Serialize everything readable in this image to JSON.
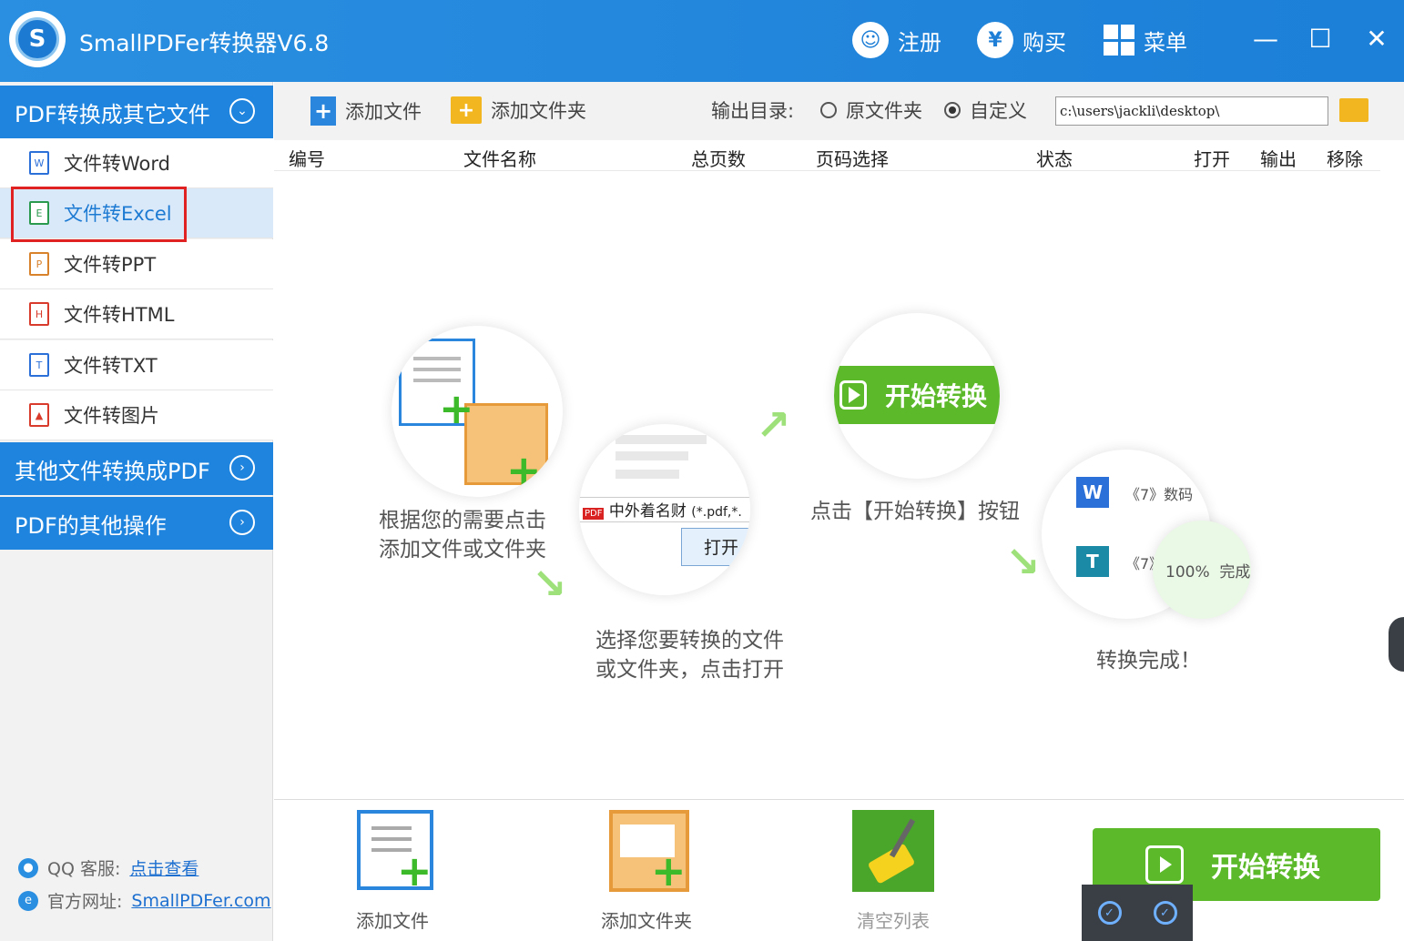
{
  "app": {
    "title": "SmallPDFer转换器V6.8",
    "logo_letter": "S"
  },
  "titlebar": {
    "register": "注册",
    "buy": "购买",
    "menu": "菜单",
    "yen": "¥"
  },
  "sidebar": {
    "sections": [
      "PDF转换成其它文件",
      "其他文件转换成PDF",
      "PDF的其他操作"
    ],
    "items": [
      {
        "label": "文件转Word",
        "icon": "W"
      },
      {
        "label": "文件转Excel",
        "icon": "E"
      },
      {
        "label": "文件转PPT",
        "icon": "P"
      },
      {
        "label": "文件转HTML",
        "icon": "H"
      },
      {
        "label": "文件转TXT",
        "icon": "T"
      },
      {
        "label": "文件转图片",
        "icon": "▲"
      }
    ],
    "qq_label": "QQ 客服:",
    "qq_link": "点击查看",
    "site_label": "官方网址:",
    "site_link": "SmallPDFer.com"
  },
  "toolbar": {
    "add_file": "添加文件",
    "add_folder": "添加文件夹",
    "output_dir": "输出目录:",
    "opt_original": "原文件夹",
    "opt_custom": "自定义",
    "path": "c:\\users\\jackli\\desktop\\"
  },
  "table": {
    "columns": [
      "编号",
      "文件名称",
      "总页数",
      "页码选择",
      "状态",
      "打开",
      "输出",
      "移除"
    ]
  },
  "guide": {
    "step1": [
      "根据您的需要点击",
      "添加文件或文件夹"
    ],
    "step2": [
      "选择您要转换的文件",
      "或文件夹，点击打开"
    ],
    "step3": "点击【开始转换】按钮",
    "step4": "转换完成！",
    "start_label": "开始转换",
    "file_name": "中外着名财",
    "filter": "(*.pdf,*.",
    "open": "打开",
    "row1": "《7》数码",
    "row2": "《7》",
    "progress": "100%",
    "done": "完成"
  },
  "bottom": {
    "add_file": "添加文件",
    "add_folder": "添加文件夹",
    "clear_list": "清空列表",
    "start": "开始转换"
  },
  "colors": {
    "brand_blue": "#1e84de",
    "start_green": "#5cba2a",
    "highlight_red": "#e02222"
  }
}
